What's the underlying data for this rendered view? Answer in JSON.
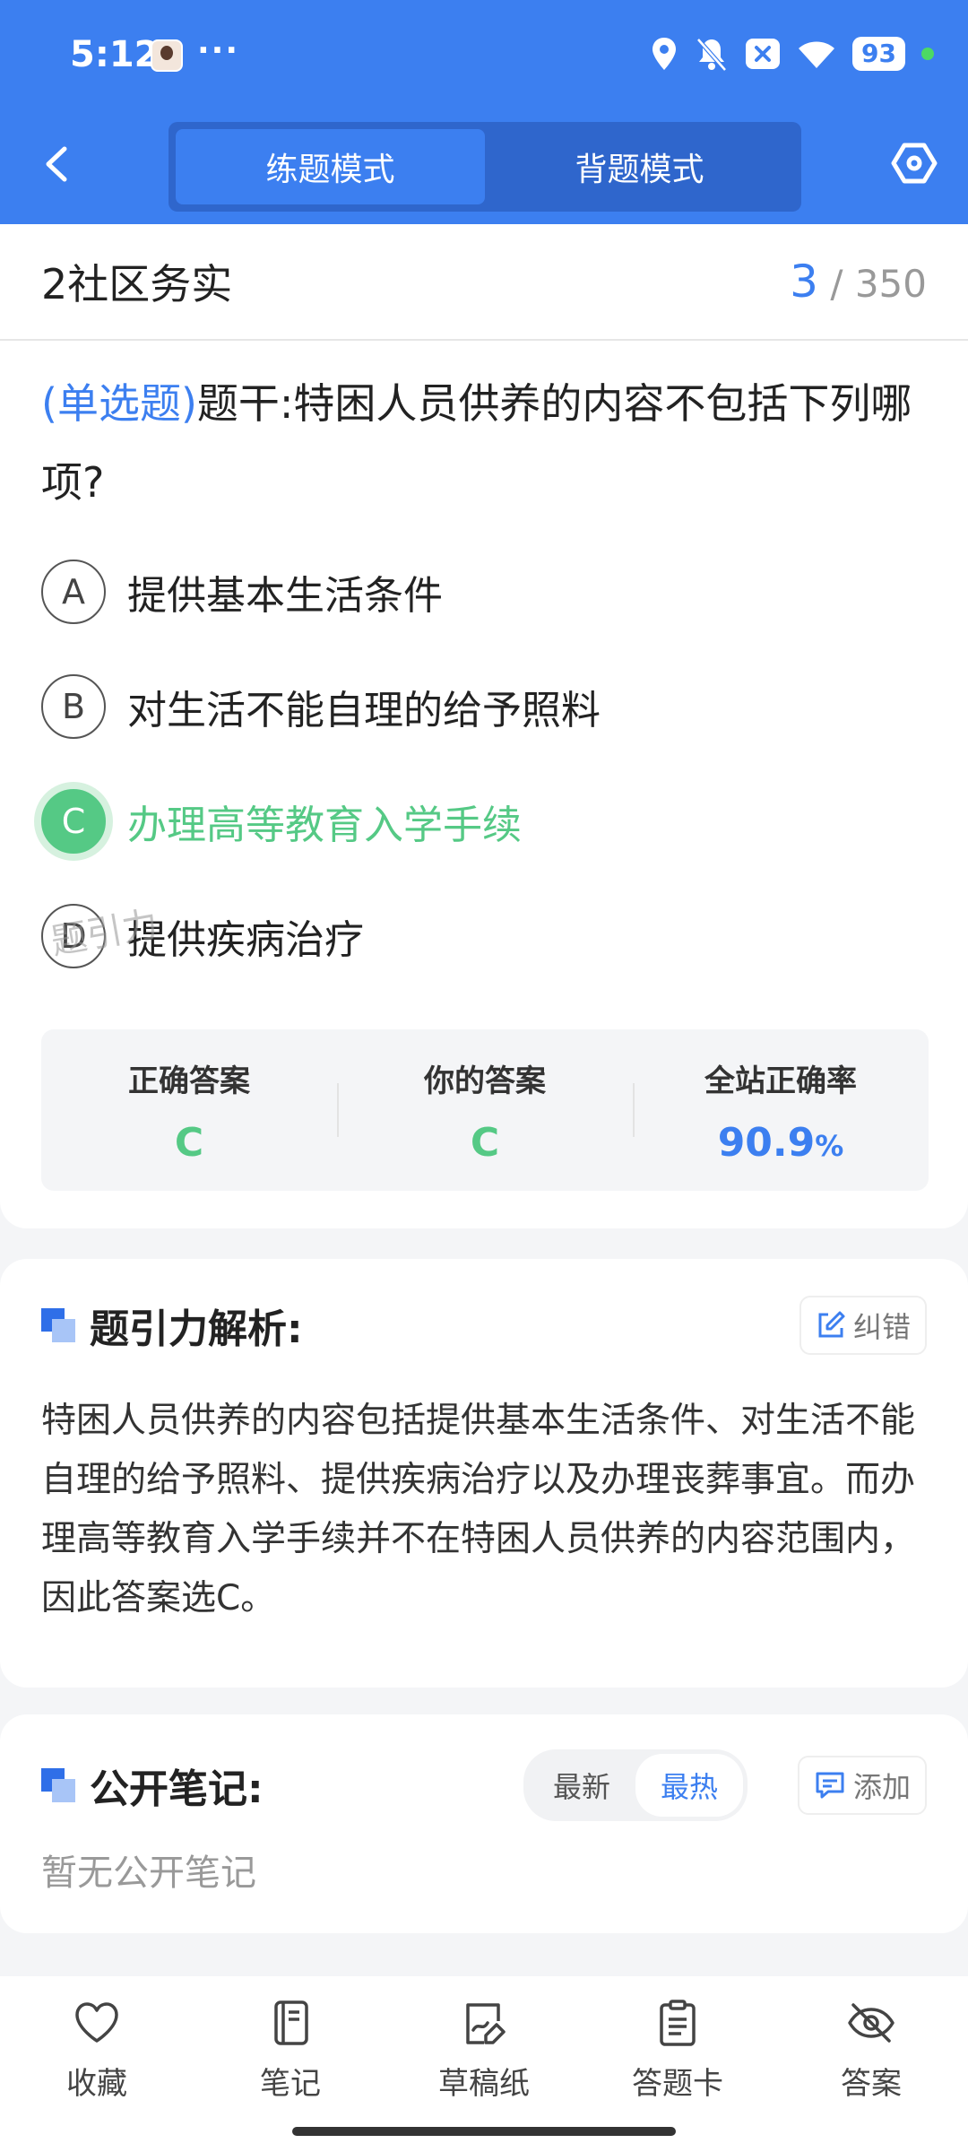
{
  "status_bar": {
    "time": "5:12",
    "dots": "···",
    "battery": "93"
  },
  "header": {
    "tabs": [
      {
        "label": "练题模式",
        "active": true
      },
      {
        "label": "背题模式",
        "active": false
      }
    ]
  },
  "section": {
    "title": "2社区务实",
    "current": "3",
    "total": "/ 350"
  },
  "question": {
    "type": "(单选题)",
    "stem": "题干:特困人员供养的内容不包括下列哪项?",
    "options": [
      {
        "letter": "A",
        "text": "提供基本生活条件"
      },
      {
        "letter": "B",
        "text": "对生活不能自理的给予照料"
      },
      {
        "letter": "C",
        "text": "办理高等教育入学手续",
        "correct": true
      },
      {
        "letter": "D",
        "text": "提供疾病治疗"
      }
    ]
  },
  "answer_box": {
    "correct_label": "正确答案",
    "correct_value": "C",
    "yours_label": "你的答案",
    "yours_value": "C",
    "rate_label": "全站正确率",
    "rate_value": "90.9",
    "rate_unit": "%",
    "watermark": "题引力"
  },
  "analysis": {
    "title": "题引力解析:",
    "report_label": "纠错",
    "text": "特困人员供养的内容包括提供基本生活条件、对生活不能自理的给予照料、提供疾病治疗以及办理丧葬事宜。而办理高等教育入学手续并不在特困人员供养的内容范围内，因此答案选C。"
  },
  "notes": {
    "title": "公开笔记:",
    "sort_options": [
      "最新",
      "最热"
    ],
    "sort_active": "最热",
    "add_label": "添加",
    "empty_text": "暂无公开笔记"
  },
  "bottom_nav": {
    "items": [
      {
        "label": "收藏",
        "icon": "heart-icon"
      },
      {
        "label": "笔记",
        "icon": "notebook-icon"
      },
      {
        "label": "草稿纸",
        "icon": "draft-icon"
      },
      {
        "label": "答题卡",
        "icon": "clipboard-icon"
      },
      {
        "label": "答案",
        "icon": "eye-off-icon"
      }
    ]
  },
  "colors": {
    "primary": "#3c7ff0",
    "correct": "#55c985"
  }
}
